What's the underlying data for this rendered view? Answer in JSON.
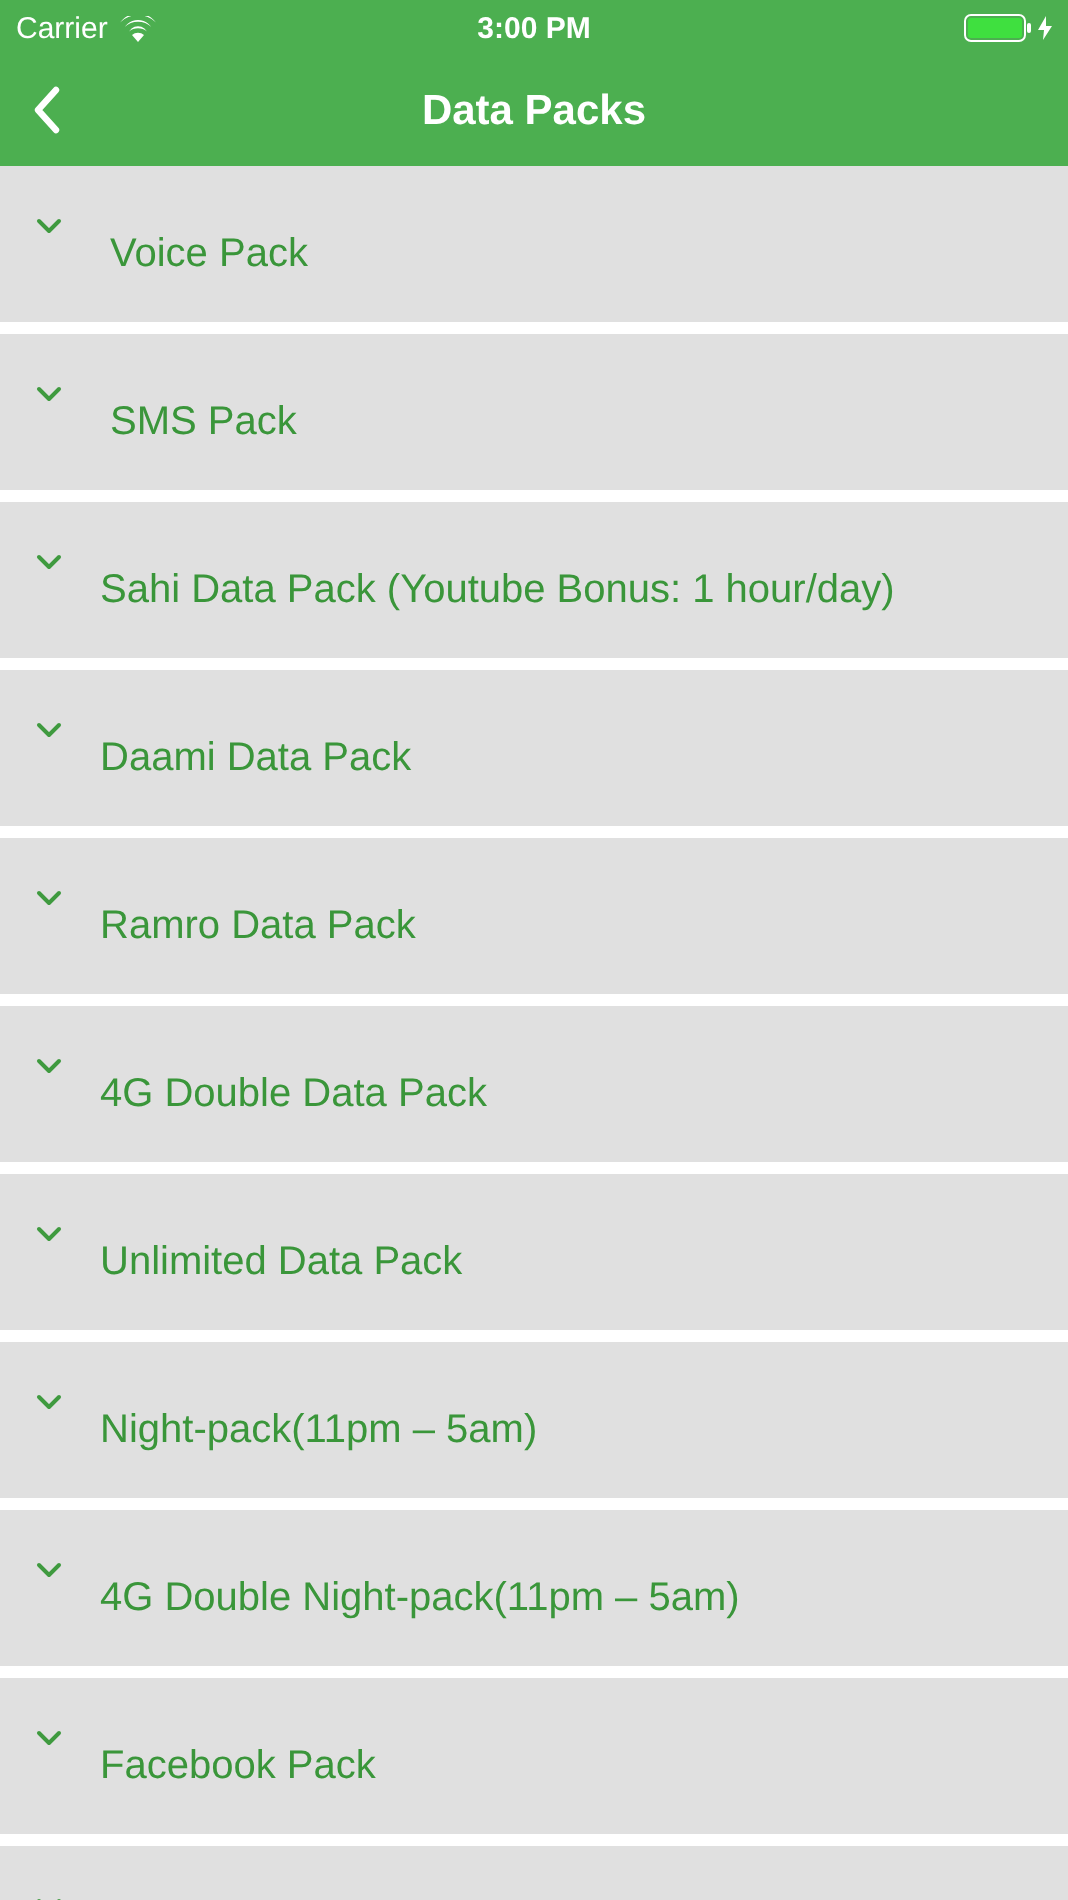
{
  "status_bar": {
    "carrier": "Carrier",
    "time": "3:00 PM",
    "charging": true
  },
  "nav": {
    "title": "Data Packs"
  },
  "packs": [
    {
      "label": "Voice Pack"
    },
    {
      "label": "SMS Pack"
    },
    {
      "label": "Sahi Data Pack (Youtube Bonus: 1 hour/day)"
    },
    {
      "label": "Daami Data Pack"
    },
    {
      "label": "Ramro Data Pack"
    },
    {
      "label": "4G Double Data Pack"
    },
    {
      "label": "Unlimited Data Pack"
    },
    {
      "label": "Night-pack(11pm – 5am)"
    },
    {
      "label": "4G Double Night-pack(11pm – 5am)"
    },
    {
      "label": "Facebook Pack"
    }
  ],
  "more_below": true
}
